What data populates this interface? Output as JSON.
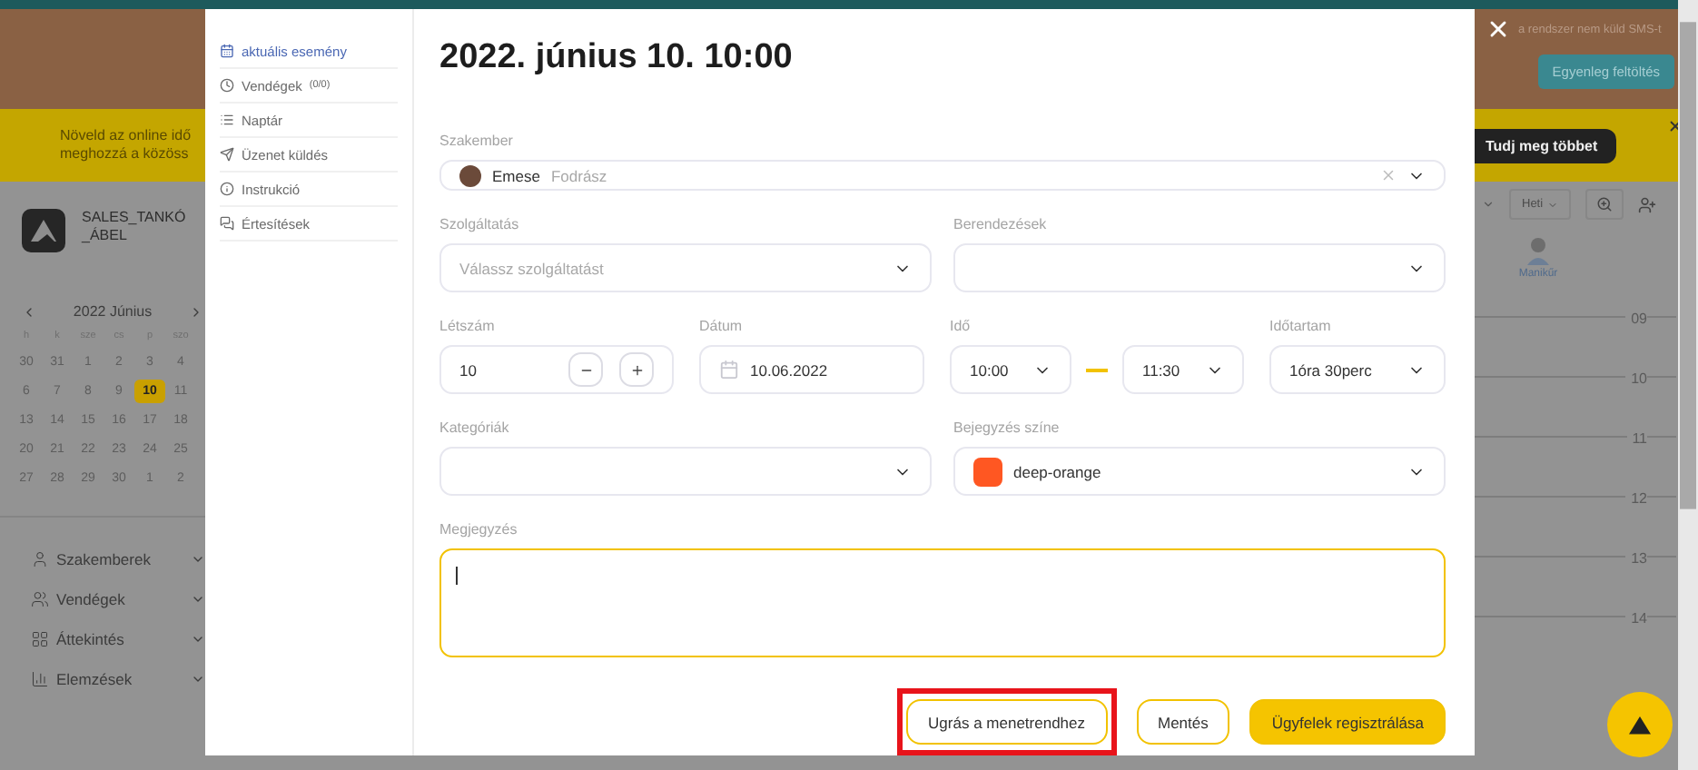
{
  "app": {
    "sms_notice": "a rendszer nem küld SMS-t",
    "topup_button": "Egyenleg feltöltés",
    "promo": {
      "lines": [
        "Növeld az online idő",
        "meghozzá a közöss"
      ],
      "cta": "Tudj meg többet"
    },
    "business": {
      "name_lines": [
        "SALES_TANKÓ",
        "_ÁBEL"
      ]
    },
    "calendar": {
      "month": "2022 Június",
      "weekdays": [
        "h",
        "k",
        "sze",
        "cs",
        "p",
        "szo"
      ],
      "weeks": [
        [
          {
            "day": "30",
            "selected": false
          },
          {
            "day": "31",
            "selected": false
          },
          {
            "day": "1",
            "selected": false
          },
          {
            "day": "2",
            "selected": false
          },
          {
            "day": "3",
            "selected": false
          },
          {
            "day": "4",
            "selected": false
          }
        ],
        [
          {
            "day": "6",
            "selected": false
          },
          {
            "day": "7",
            "selected": false
          },
          {
            "day": "8",
            "selected": false
          },
          {
            "day": "9",
            "selected": false
          },
          {
            "day": "10",
            "selected": true
          },
          {
            "day": "11",
            "selected": false
          }
        ],
        [
          {
            "day": "13",
            "selected": false
          },
          {
            "day": "14",
            "selected": false
          },
          {
            "day": "15",
            "selected": false
          },
          {
            "day": "16",
            "selected": false
          },
          {
            "day": "17",
            "selected": false
          },
          {
            "day": "18",
            "selected": false
          }
        ],
        [
          {
            "day": "20",
            "selected": false
          },
          {
            "day": "21",
            "selected": false
          },
          {
            "day": "22",
            "selected": false
          },
          {
            "day": "23",
            "selected": false
          },
          {
            "day": "24",
            "selected": false
          },
          {
            "day": "25",
            "selected": false
          }
        ],
        [
          {
            "day": "27",
            "selected": false
          },
          {
            "day": "28",
            "selected": false
          },
          {
            "day": "29",
            "selected": false
          },
          {
            "day": "30",
            "selected": false
          },
          {
            "day": "1",
            "selected": false
          },
          {
            "day": "2",
            "selected": false
          }
        ]
      ]
    },
    "nav": [
      {
        "label": "Szakemberek"
      },
      {
        "label": "Vendégek"
      },
      {
        "label": "Áttekintés"
      },
      {
        "label": "Elemzések"
      }
    ],
    "toolbar": {
      "view": "Heti"
    },
    "staff": {
      "role": "Manikűr"
    },
    "hours": [
      "09",
      "10",
      "11",
      "12",
      "13",
      "14"
    ]
  },
  "modal": {
    "menu": [
      {
        "label": "aktuális esemény",
        "selected": true
      },
      {
        "label": "Vendégek",
        "count": "(0/0)",
        "selected": false
      },
      {
        "label": "Naptár",
        "selected": false
      },
      {
        "label": "Üzenet küldés",
        "selected": false
      },
      {
        "label": "Instrukció",
        "selected": false
      },
      {
        "label": "Értesítések",
        "selected": false
      }
    ],
    "title": "2022. június 10. 10:00",
    "specialist": {
      "label": "Szakember",
      "name": "Emese",
      "role": "Fodrász"
    },
    "service": {
      "label": "Szolgáltatás",
      "placeholder": "Válassz szolgáltatást"
    },
    "equipment": {
      "label": "Berendezések"
    },
    "headcount": {
      "label": "Létszám",
      "value": "10"
    },
    "date": {
      "label": "Dátum",
      "value": "10.06.2022"
    },
    "time": {
      "label": "Idő",
      "start": "10:00",
      "end": "11:30"
    },
    "duration": {
      "label": "Időtartam",
      "value": "1óra 30perc"
    },
    "categories": {
      "label": "Kategóriák"
    },
    "entry_color": {
      "label": "Bejegyzés színe",
      "value": "deep-orange",
      "color": "#ff5722"
    },
    "note": {
      "label": "Megjegyzés",
      "focused": true
    },
    "buttons": [
      {
        "label": "Ugrás a menetrendhez",
        "kind": "outline",
        "highlighted": true
      },
      {
        "label": "Mentés",
        "kind": "outline",
        "highlighted": false
      },
      {
        "label": "Ügyfelek regisztrálása",
        "kind": "primary",
        "highlighted": false
      }
    ]
  }
}
